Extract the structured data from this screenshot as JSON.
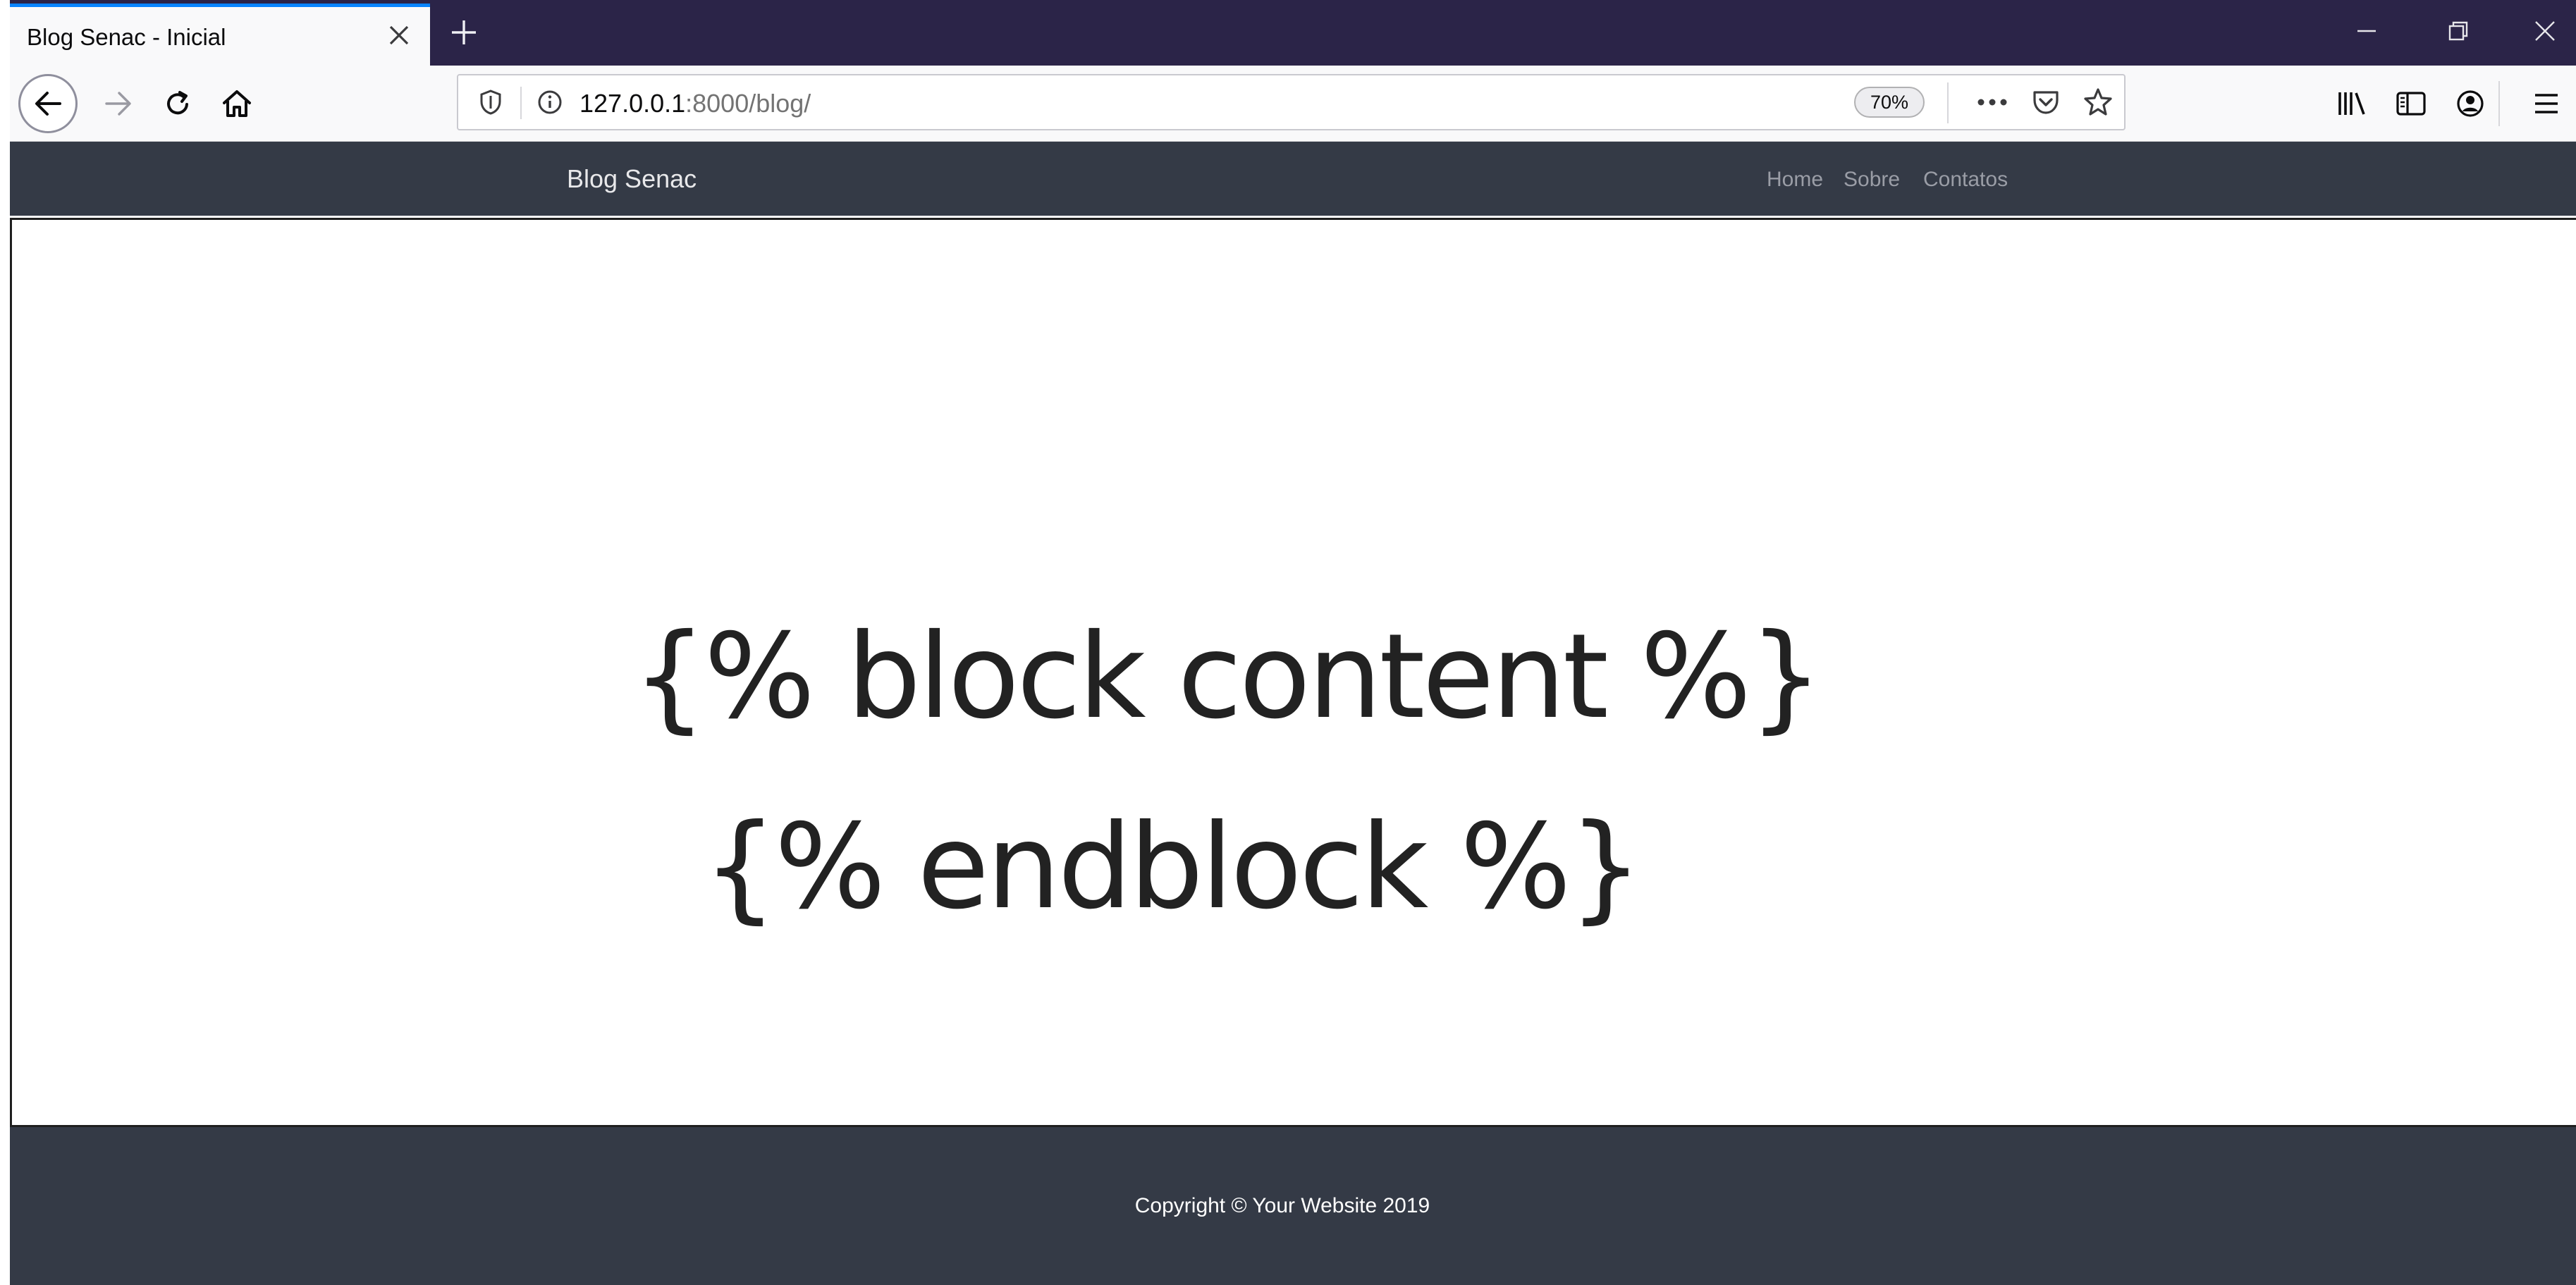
{
  "browser": {
    "tab": {
      "title": "Blog Senac - Inicial",
      "close_icon": "close-icon"
    },
    "new_tab_icon": "plus-icon",
    "window_controls": [
      "minimize-icon",
      "restore-icon",
      "close-icon"
    ],
    "nav_icons": [
      "back-arrow-icon",
      "forward-arrow-icon",
      "reload-icon",
      "home-icon"
    ],
    "url": {
      "host": "127.0.0.1",
      "path": ":8000/blog/"
    },
    "zoom": "70%",
    "toolbar_icons": [
      "page-actions-icon",
      "pocket-icon",
      "bookmark-star-icon",
      "library-icon",
      "sidebar-icon",
      "account-icon",
      "menu-icon"
    ],
    "colors": {
      "tabstrip": "#2b2448",
      "accent": "#0a84ff"
    }
  },
  "site": {
    "brand": "Blog Senac",
    "nav_links": [
      "Home",
      "Sobre",
      "Contatos"
    ],
    "template_lines": [
      "{% block content %}",
      "{% endblock %}"
    ],
    "footer_text": "Copyright © Your Website 2019",
    "colors": {
      "navbar": "#343a46",
      "footer": "#343a46"
    }
  }
}
